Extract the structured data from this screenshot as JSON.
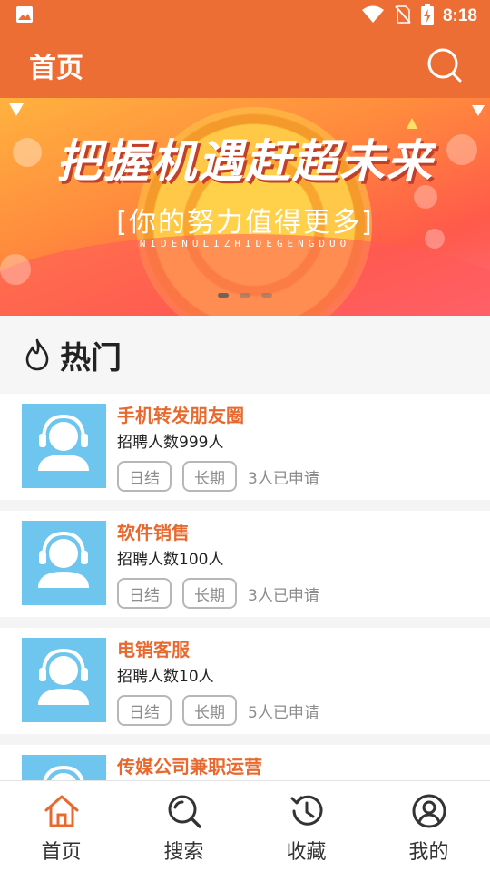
{
  "status_bar": {
    "time": "8:18"
  },
  "app_bar": {
    "title": "首页"
  },
  "banner": {
    "headline": "把握机遇赶超未来",
    "subtitle": "[你的努力值得更多]",
    "pinyin": "NIDENULIZHIDEGENGDUO",
    "pages": 3,
    "active_page": 1
  },
  "section": {
    "title": "热门"
  },
  "jobs": [
    {
      "title": "手机转发朋友圈",
      "count": "招聘人数999人",
      "tags": [
        "日结",
        "长期"
      ],
      "applied": "3人已申请"
    },
    {
      "title": "软件销售",
      "count": "招聘人数100人",
      "tags": [
        "日结",
        "长期"
      ],
      "applied": "3人已申请"
    },
    {
      "title": "电销客服",
      "count": "招聘人数10人",
      "tags": [
        "日结",
        "长期"
      ],
      "applied": "5人已申请"
    },
    {
      "title": "传媒公司兼职运营",
      "count": "",
      "tags": [],
      "applied": ""
    }
  ],
  "bottom_nav": [
    {
      "label": "首页",
      "icon": "home-icon",
      "active": true
    },
    {
      "label": "搜索",
      "icon": "search-icon",
      "active": false
    },
    {
      "label": "收藏",
      "icon": "history-icon",
      "active": false
    },
    {
      "label": "我的",
      "icon": "profile-icon",
      "active": false
    }
  ],
  "colors": {
    "primary": "#ec6e35",
    "job_title": "#e8692f",
    "avatar_bg": "#6ec6ef"
  }
}
